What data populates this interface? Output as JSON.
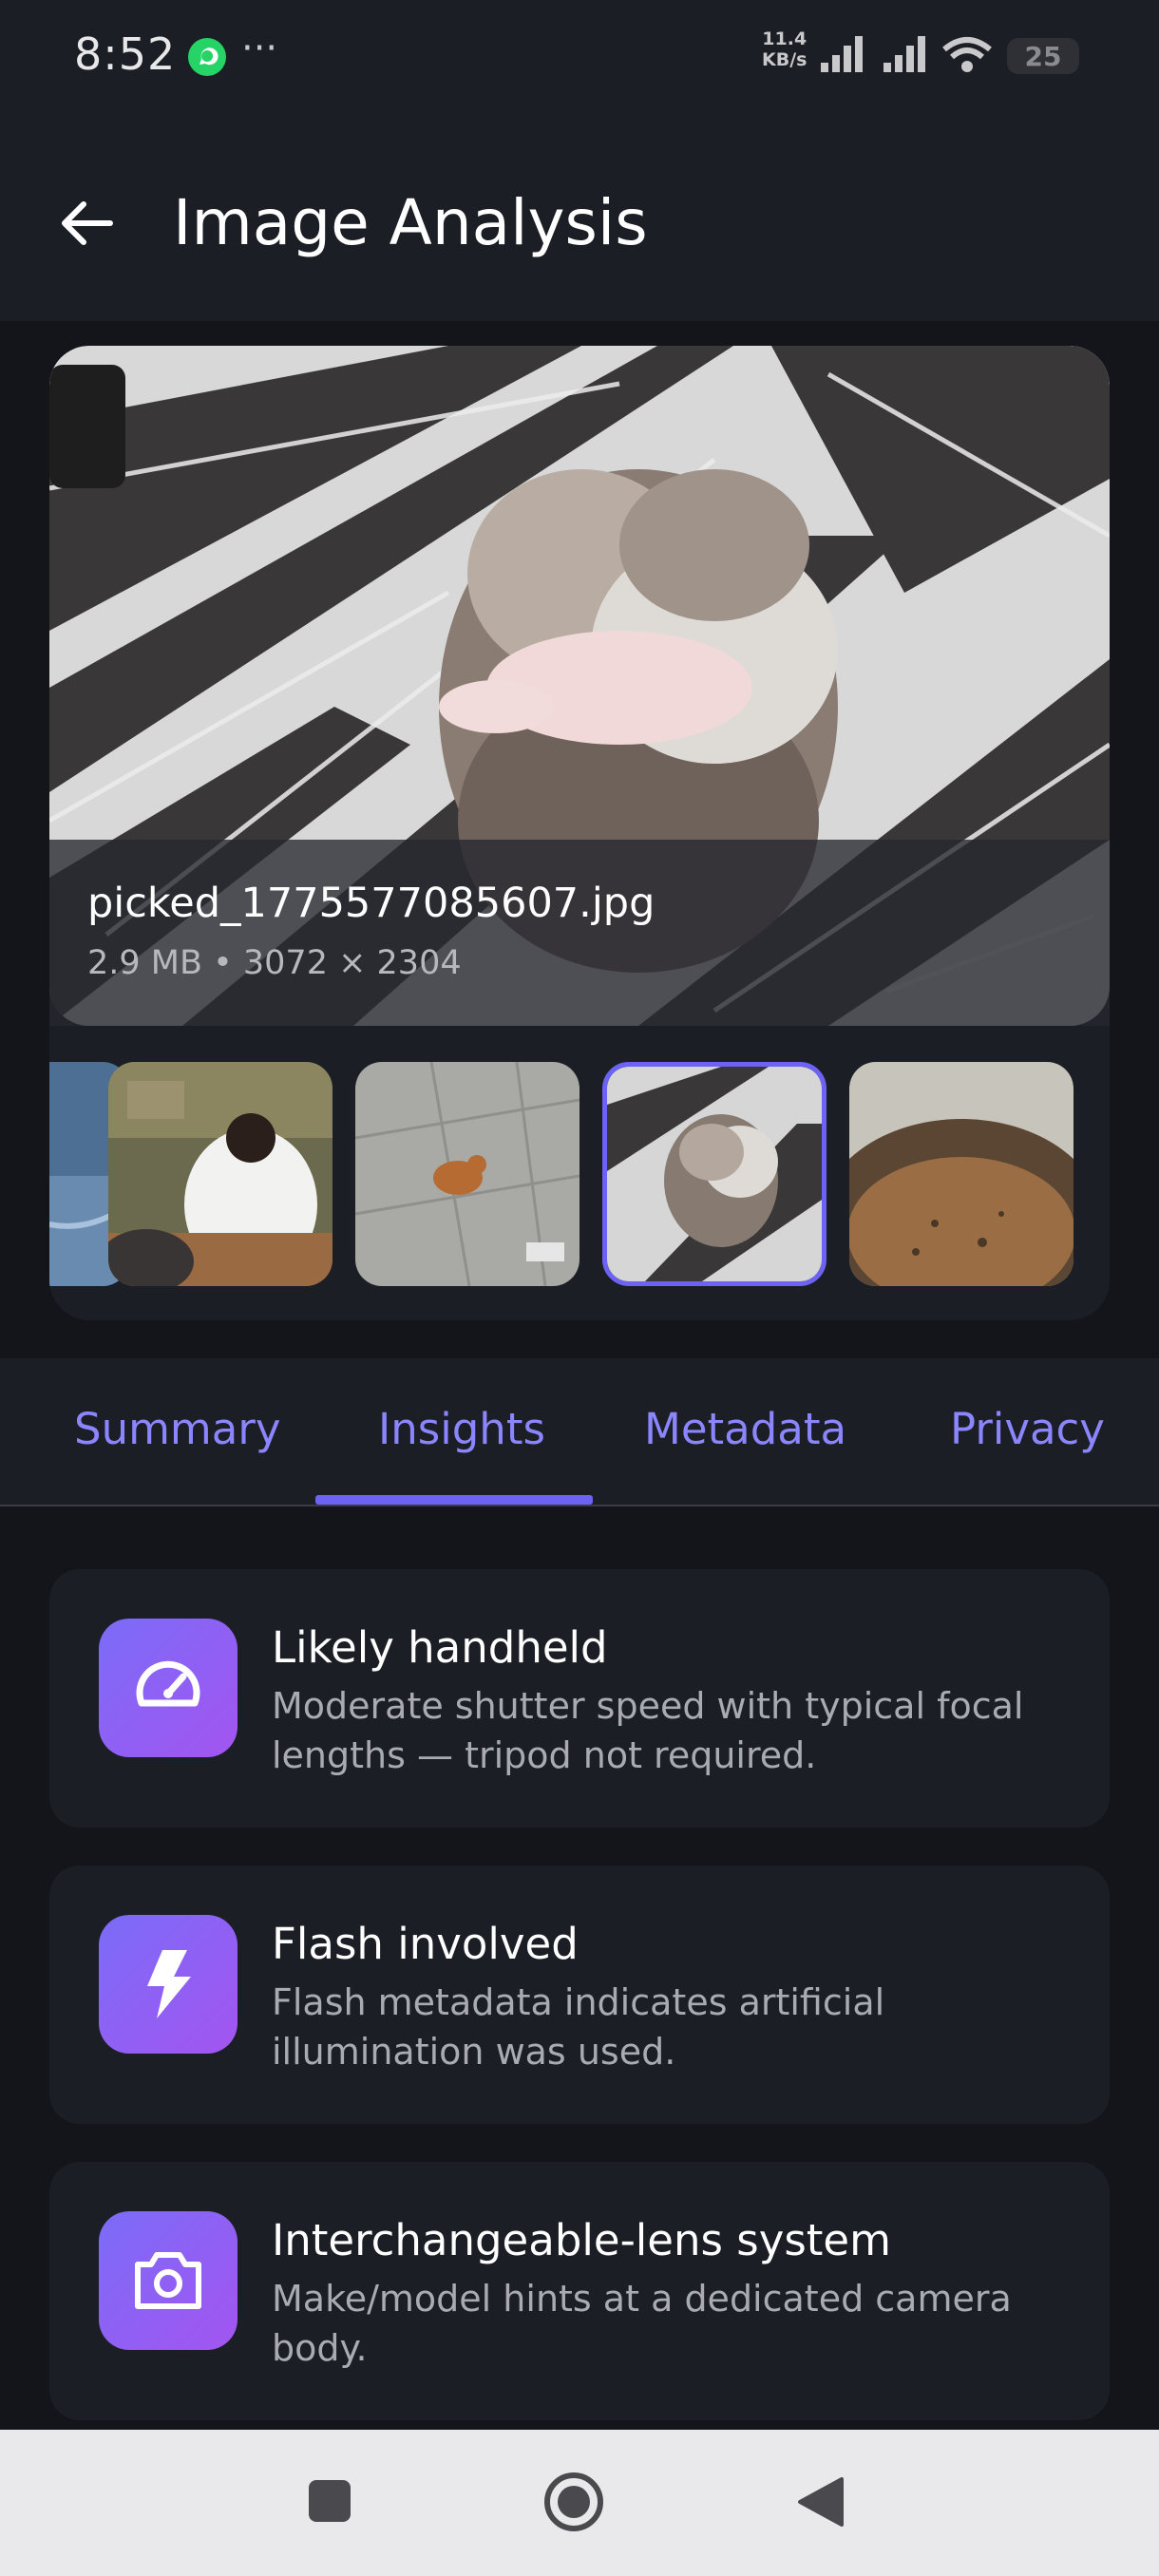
{
  "status_bar": {
    "time": "8:52",
    "dots": "···",
    "net_speed_value": "11.4",
    "net_speed_unit": "KB/s",
    "battery": "25"
  },
  "app_bar": {
    "title": "Image Analysis"
  },
  "image": {
    "file_name": "picked_1775577085607.jpg",
    "file_meta": "2.9 MB  •  3072 × 2304"
  },
  "thumbnails": [
    {
      "name": "thumb-water",
      "selected": false
    },
    {
      "name": "thumb-classroom",
      "selected": false
    },
    {
      "name": "thumb-cat-on-pavement",
      "selected": false
    },
    {
      "name": "thumb-kittens",
      "selected": true
    },
    {
      "name": "thumb-soil-pot",
      "selected": false
    }
  ],
  "tabs": {
    "summary": "Summary",
    "insights": "Insights",
    "metadata": "Metadata",
    "privacy": "Privacy",
    "active": "Insights"
  },
  "insights": [
    {
      "icon": "speedometer-icon",
      "title": "Likely handheld",
      "description": "Moderate shutter speed with typical focal lengths — tripod not required."
    },
    {
      "icon": "flash-icon",
      "title": "Flash involved",
      "description": "Flash metadata indicates artificial illumination was used."
    },
    {
      "icon": "camera-icon",
      "title": "Interchangeable-lens system",
      "description": "Make/model hints at a dedicated camera body."
    }
  ],
  "colors": {
    "accent": "#6c63f5",
    "tab_text": "#8b86ff",
    "background": "#13151a",
    "surface": "#1b1e24"
  }
}
